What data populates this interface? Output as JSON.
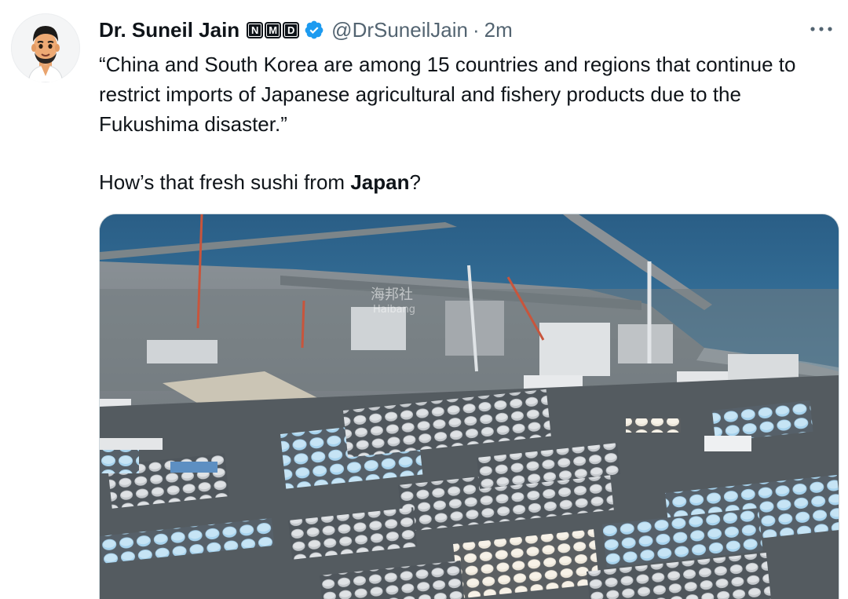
{
  "tweet": {
    "author": {
      "display_name": "Dr. Suneil Jain",
      "badges": [
        "N",
        "M",
        "D"
      ],
      "handle": "@DrSuneilJain",
      "separator": "·",
      "timestamp": "2m",
      "avatar_icon": "memoji-avatar-icon",
      "verified_icon": "verified-badge-icon"
    },
    "text": {
      "quote": "“China and South Korea are among 15 countries and regions that continue to restrict imports of Japanese agricultural and fishery products due to the Fukushima disaster.”",
      "question_prefix": "How’s that fresh sushi from ",
      "question_bold": "Japan",
      "question_suffix": "?"
    },
    "more_icon": "more-horizontal-icon",
    "media": {
      "watermark_line1": "海邦社",
      "watermark_line2": "Haibang"
    }
  },
  "colors": {
    "verified_blue": "#1d9bf0",
    "text_primary": "#0f1419",
    "text_secondary": "#536471",
    "sea_blue": "#2f6890",
    "tank_blue": "#9ccbe8",
    "tank_grey": "#c9ccd0"
  }
}
